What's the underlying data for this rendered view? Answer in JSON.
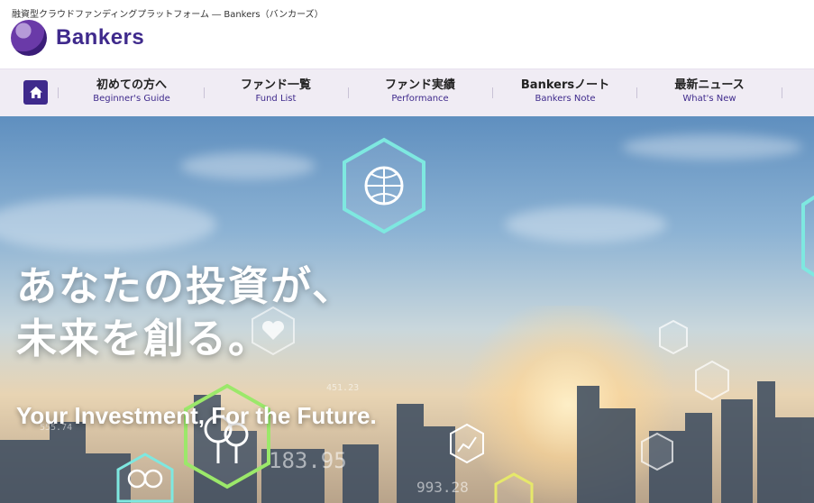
{
  "header": {
    "tagline": "融資型クラウドファンディングプラットフォーム ― Bankers（バンカーズ）",
    "logo_text": "Bankers",
    "logo_icon": "bankers-logo-mark"
  },
  "nav": {
    "home_icon": "home-icon",
    "items": [
      {
        "jp": "初めての方へ",
        "en": "Beginner's Guide"
      },
      {
        "jp": "ファンド一覧",
        "en": "Fund List"
      },
      {
        "jp": "ファンド実績",
        "en": "Performance"
      },
      {
        "jp": "Bankersノート",
        "en": "Bankers Note"
      },
      {
        "jp": "最新ニュース",
        "en": "What's New"
      }
    ]
  },
  "hero": {
    "headline_line1": "あなたの投資が、",
    "headline_line2": "未来を創る。",
    "subheadline": "Your Investment, For the Future.",
    "numbers": [
      "183.95",
      "993.28",
      "555.74",
      "451.23"
    ]
  },
  "colors": {
    "brand": "#3f2a8c",
    "nav_bg": "#f0ecf4",
    "hex_cyan": "#7ee8e0",
    "hex_green": "#9be86a"
  }
}
